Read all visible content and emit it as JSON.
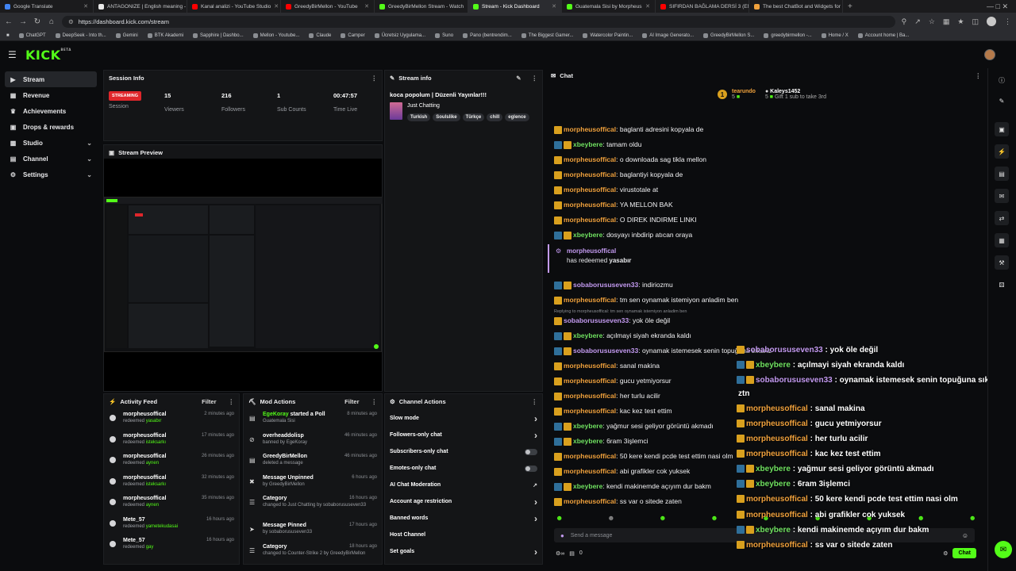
{
  "tabs": [
    {
      "title": "Google Translate",
      "color": "#4285f4"
    },
    {
      "title": "ANTAGONIZE | English meaning -",
      "color": "#e8e8e8"
    },
    {
      "title": "Kanal analizi - YouTube Studio",
      "color": "#ff0000"
    },
    {
      "title": "GreedyBirMellon - YouTube",
      "color": "#ff0000"
    },
    {
      "title": "GreedyBirMellon Stream - Watch",
      "color": "#53fc18"
    },
    {
      "title": "Stream - Kick Dashboard",
      "color": "#53fc18",
      "active": true
    },
    {
      "title": "Guatemala Sisi by Morpheus",
      "color": "#53fc18"
    },
    {
      "title": "SIFIRDAN BAĞLAMA DERSİ 3 (EN",
      "color": "#ff0000"
    },
    {
      "title": "The best ChatBot and Widgets for",
      "color": "#f0a13c"
    }
  ],
  "url": "https://dashboard.kick.com/stream",
  "bookmarks": [
    "ChatGPT",
    "DeepSeek - Into th...",
    "Gemini",
    "BTK Akademi",
    "Sapphire | Dashbo...",
    "Mellon - Youtube...",
    "Claude",
    "Camper",
    "Ücretsiz Uygulama...",
    "Suno",
    "Pano (bentrendim...",
    "The Biggest Gamer...",
    "Watercolor Paintin...",
    "AI Image Generato...",
    "GreedyBirMellon S...",
    "greedybirmellon -...",
    "Home / X",
    "Account home | Ba..."
  ],
  "logo": "KICK",
  "logo_sup": "BETA",
  "sidebar": [
    {
      "label": "Stream",
      "icon": "video-icon",
      "active": true
    },
    {
      "label": "Revenue",
      "icon": "revenue-icon"
    },
    {
      "label": "Achievements",
      "icon": "trophy-icon"
    },
    {
      "label": "Drops & rewards",
      "icon": "gift-icon"
    },
    {
      "label": "Studio",
      "icon": "studio-icon",
      "chev": true
    },
    {
      "label": "Channel",
      "icon": "channel-icon",
      "chev": true
    },
    {
      "label": "Settings",
      "icon": "gear-icon",
      "chev": true
    }
  ],
  "session": {
    "title": "Session Info",
    "status": "STREAMING",
    "session_label": "Session",
    "stats": [
      {
        "value": "15",
        "label": "Viewers"
      },
      {
        "value": "216",
        "label": "Followers"
      },
      {
        "value": "1",
        "label": "Sub Counts"
      },
      {
        "value": "00:47:57",
        "label": "Time Live"
      }
    ]
  },
  "preview": {
    "title": "Stream Preview"
  },
  "stream_info": {
    "title": "Stream info",
    "stream_title": "koca popolum | Düzenli Yayınlar!!!",
    "category": "Just Chatting",
    "tags": [
      "Turkish",
      "Soulslike",
      "Türkçe",
      "chill",
      "eglence"
    ]
  },
  "activity": {
    "title": "Activity Feed",
    "filter": "Filter",
    "items": [
      {
        "user": "morpheusoffical",
        "action": "redeemed",
        "reward": "yasabır",
        "time": "2 minutes ago"
      },
      {
        "user": "morpheusoffical",
        "action": "redeemed",
        "reward": "isteksarkı",
        "time": "17 minutes ago"
      },
      {
        "user": "morpheusoffical",
        "action": "redeemed",
        "reward": "aynen",
        "time": "26 minutes ago"
      },
      {
        "user": "morpheusoffical",
        "action": "redeemed",
        "reward": "isteksarkı",
        "time": "32 minutes ago"
      },
      {
        "user": "morpheusoffical",
        "action": "redeemed",
        "reward": "aynen",
        "time": "35 minutes ago"
      },
      {
        "user": "Mete_57",
        "action": "redeemed",
        "reward": "yametekudasai",
        "time": "16 hours ago"
      },
      {
        "user": "Mete_57",
        "action": "redeemed",
        "reward": "gay",
        "time": "16 hours ago"
      }
    ]
  },
  "mod": {
    "title": "Mod Actions",
    "filter": "Filter",
    "items": [
      {
        "user": "EgeKoray",
        "rest": "started a Poll",
        "sub": "Guatemala Sisi",
        "time": "8 minutes ago",
        "icon": "poll-icon"
      },
      {
        "user": "overheaddolisp",
        "rest": "",
        "sub": "banned by EgeKoray",
        "time": "46 minutes ago",
        "icon": "ban-icon"
      },
      {
        "user": "GreedyBirMellon",
        "rest": "",
        "sub": "deleted a message",
        "time": "46 minutes ago",
        "icon": "trash-icon"
      },
      {
        "user": "Message Unpinned",
        "rest": "",
        "sub": "by GreedyBirMellon",
        "time": "6 hours ago",
        "icon": "unpin-icon"
      },
      {
        "user": "Category",
        "rest": "",
        "sub": "changed to Just Chatting by sobaborususeven33",
        "time": "16 hours ago",
        "icon": "category-icon"
      },
      {
        "user": "Message Pinned",
        "rest": "",
        "sub": "by sobaborususeven33",
        "time": "17 hours ago",
        "icon": "pin-icon"
      },
      {
        "user": "Category",
        "rest": "",
        "sub": "changed to Counter-Strike 2 by GreedyBirMellon",
        "time": "18 hours ago",
        "icon": "category-icon"
      }
    ]
  },
  "channel_actions": {
    "title": "Channel Actions",
    "items": [
      "Slow mode",
      "Followers-only chat",
      "Subscribers-only chat",
      "Emotes-only chat",
      "AI Chat Moderation",
      "Account age restriction",
      "Banned words",
      "Host Channel",
      "Set goals"
    ]
  },
  "chat": {
    "title": "Chat",
    "top_user": "tearundo",
    "top_count": "5",
    "gift_user": "Kaleys1452",
    "gift_count": "5",
    "gift_text": "Gift 1 sub to take 3rd",
    "input_placeholder": "Send a message",
    "count": "0",
    "send": "Chat",
    "redeem_user": "morpheusoffical",
    "redeem_text": "has redeemed",
    "redeem_reward": "yasabır",
    "reply_to": "Replying to morpheusoffical: tm sen oynamak istemiyon anladim ben",
    "messages": [
      {
        "user": "morpheusoffical",
        "text": "baglanti adresini kopyala de",
        "c": "orange",
        "b": "gold"
      },
      {
        "user": "xbeybere",
        "text": "tamam oldu",
        "c": "green",
        "b": "blue"
      },
      {
        "user": "morpheusoffical",
        "text": "o downloada sag tikla mellon",
        "c": "orange",
        "b": "gold"
      },
      {
        "user": "morpheusoffical",
        "text": "baglantiyi kopyala de",
        "c": "orange",
        "b": "gold"
      },
      {
        "user": "morpheusoffical",
        "text": "virustotale at",
        "c": "orange",
        "b": "gold"
      },
      {
        "user": "morpheusoffical",
        "text": "YA MELLON BAK",
        "c": "orange",
        "b": "gold"
      },
      {
        "user": "morpheusoffical",
        "text": "O DIREK INDIRME LINKI",
        "c": "orange",
        "b": "gold"
      },
      {
        "user": "xbeybere",
        "text": "dosyayı inbdirip atıcan oraya",
        "c": "green",
        "b": "blue"
      },
      {
        "user": "sobaborususeven33",
        "text": "indiriozmu",
        "c": "purple",
        "b": "blue"
      },
      {
        "user": "morpheusoffical",
        "text": "tm sen oynamak istemiyon anladim ben",
        "c": "orange",
        "b": "gold"
      },
      {
        "user": "sobaborususeven33",
        "text": "yok öle değil",
        "c": "purple",
        "b": "gold"
      },
      {
        "user": "xbeybere",
        "text": "açılmayi siyah ekranda kaldı",
        "c": "green",
        "b": "blue"
      },
      {
        "user": "sobaborususeven33",
        "text": "oynamak istemesek senin topuğuna sıkarız",
        "c": "purple",
        "b": "blue"
      },
      {
        "user": "morpheusoffical",
        "text": "sanal makina",
        "c": "orange",
        "b": "gold"
      },
      {
        "user": "morpheusoffical",
        "text": "gucu yetmiyorsur",
        "c": "orange",
        "b": "gold"
      },
      {
        "user": "morpheusoffical",
        "text": "her turlu acilir",
        "c": "orange",
        "b": "gold"
      },
      {
        "user": "morpheusoffical",
        "text": "kac kez test ettim",
        "c": "orange",
        "b": "gold"
      },
      {
        "user": "xbeybere",
        "text": "yağmur sesi geliyor görüntü akmadı",
        "c": "green",
        "b": "blue"
      },
      {
        "user": "xbeybere",
        "text": "6ram 3işlemci",
        "c": "green",
        "b": "blue"
      },
      {
        "user": "morpheusoffical",
        "text": "50 kere kendi pcde test ettim nasi olm",
        "c": "orange",
        "b": "gold"
      },
      {
        "user": "morpheusoffical",
        "text": "abi grafikler cok yuksek",
        "c": "orange",
        "b": "gold"
      },
      {
        "user": "xbeybere",
        "text": "kendi makinemde açıyım dur bakm",
        "c": "green",
        "b": "blue"
      },
      {
        "user": "morpheusoffical",
        "text": "ss var o sitede zaten",
        "c": "orange",
        "b": "gold"
      }
    ],
    "overlay": [
      {
        "user": "sobaborususeven33",
        "text": "yok öle değil",
        "c": "purple",
        "b": "gold"
      },
      {
        "user": "xbeybere",
        "text": "açılmayi siyah ekranda kaldı",
        "c": "green",
        "b": "blue"
      },
      {
        "user": "sobaborususeven33",
        "text": "oynamak istemesek senin topuğuna sıkarız",
        "c": "purple",
        "b": "blue"
      },
      {
        "user": "",
        "text": "ztn",
        "c": "orange",
        "b": ""
      },
      {
        "user": "morpheusoffical",
        "text": "sanal makina",
        "c": "orange",
        "b": "gold"
      },
      {
        "user": "morpheusoffical",
        "text": "gucu yetmiyorsur",
        "c": "orange",
        "b": "gold"
      },
      {
        "user": "morpheusoffical",
        "text": "her turlu acilir",
        "c": "orange",
        "b": "gold"
      },
      {
        "user": "morpheusoffical",
        "text": "kac kez test ettim",
        "c": "orange",
        "b": "gold"
      },
      {
        "user": "xbeybere",
        "text": "yağmur sesi geliyor görüntü akmadı",
        "c": "green",
        "b": "blue"
      },
      {
        "user": "xbeybere",
        "text": "6ram 3işlemci",
        "c": "green",
        "b": "blue"
      },
      {
        "user": "morpheusoffical",
        "text": "50 kere kendi pcde test ettim nasi olm",
        "c": "orange",
        "b": "gold"
      },
      {
        "user": "morpheusoffical",
        "text": "abi grafikler cok yuksek",
        "c": "orange",
        "b": "gold"
      },
      {
        "user": "xbeybere",
        "text": "kendi makinemde açıyım dur bakm",
        "c": "green",
        "b": "blue"
      },
      {
        "user": "morpheusoffical",
        "text": "ss var o sitede zaten",
        "c": "orange",
        "b": "gold"
      }
    ]
  },
  "colors": {
    "accent": "#53fc18",
    "live": "#e0262b"
  }
}
